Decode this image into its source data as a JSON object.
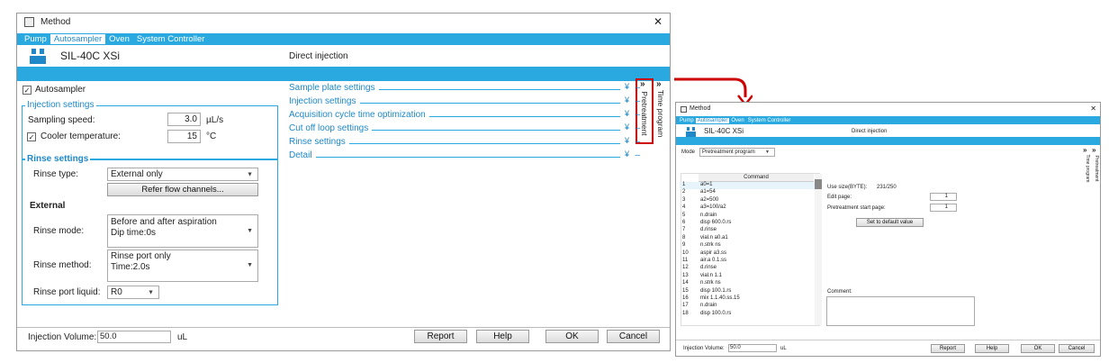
{
  "main": {
    "title": "Method",
    "close": "✕",
    "tabs": [
      "Pump",
      "Autosampler",
      "Oven",
      "System Controller"
    ],
    "model": "SIL-40C XSi",
    "mode_label": "Direct injection",
    "autosampler_check": "Autosampler",
    "injection_settings": {
      "title": "Injection settings",
      "sampling_speed_label": "Sampling speed:",
      "sampling_speed_value": "3.0",
      "sampling_speed_unit": "µL/s",
      "cooler_label": "Cooler temperature:",
      "cooler_value": "15",
      "cooler_unit": "°C"
    },
    "rinse_settings": {
      "title": "Rinse settings",
      "rinse_type_label": "Rinse type:",
      "rinse_type_value": "External only",
      "refer_button": "Refer flow channels...",
      "external_heading": "External",
      "rinse_mode_label": "Rinse mode:",
      "rinse_mode_line1": "Before and after aspiration",
      "rinse_mode_line2": "Dip time:0s",
      "rinse_method_label": "Rinse method:",
      "rinse_method_line1": "Rinse port only",
      "rinse_method_line2": "Time:2.0s",
      "rinse_port_label": "Rinse port liquid:",
      "rinse_port_value": "R0"
    },
    "sections": [
      "Sample plate settings",
      "Injection settings",
      "Acquisition cycle time optimization",
      "Cut off loop settings",
      "Rinse settings",
      "Detail"
    ],
    "side_tabs": {
      "pretreatment": "Pretreatment",
      "time_program": "Time program"
    },
    "footer": {
      "injection_volume_label": "Injection Volume:",
      "injection_volume_value": "50.0",
      "injection_volume_unit": "uL",
      "report": "Report",
      "help": "Help",
      "ok": "OK",
      "cancel": "Cancel"
    }
  },
  "second": {
    "title": "Method",
    "close": "✕",
    "tabs": [
      "Pump",
      "Autosampler",
      "Oven",
      "System Controller"
    ],
    "model": "SIL-40C XSi",
    "mode_label_top": "Direct injection",
    "mode_label": "Mode",
    "mode_value": "Pretreatment program",
    "command_header": "Command",
    "commands": [
      {
        "n": "1",
        "c": "a0=1"
      },
      {
        "n": "2",
        "c": "a1=54"
      },
      {
        "n": "3",
        "c": "a2=500"
      },
      {
        "n": "4",
        "c": "a3=100/a2"
      },
      {
        "n": "5",
        "c": "n.drain"
      },
      {
        "n": "6",
        "c": "disp 600.0.rs"
      },
      {
        "n": "7",
        "c": "d.rinse"
      },
      {
        "n": "8",
        "c": "vial.n a0.a1"
      },
      {
        "n": "9",
        "c": "n.strk ns"
      },
      {
        "n": "10",
        "c": "aspir a3.ss"
      },
      {
        "n": "11",
        "c": "air.a 0.1.ss"
      },
      {
        "n": "12",
        "c": "d.rinse"
      },
      {
        "n": "13",
        "c": "vial.n 1.1"
      },
      {
        "n": "14",
        "c": "n.strk ns"
      },
      {
        "n": "15",
        "c": "disp 100.1.rs"
      },
      {
        "n": "16",
        "c": "mix 1.1.40.ss.15"
      },
      {
        "n": "17",
        "c": "n.drain"
      },
      {
        "n": "18",
        "c": "disp 100.0.rs"
      }
    ],
    "use_size_label": "Use size(BYTE):",
    "use_size_value": "231/250",
    "edit_page_label": "Edit page:",
    "edit_page_value": "1",
    "start_page_label": "Pretreatment start page:",
    "start_page_value": "1",
    "default_button": "Set to default value",
    "comment_label": "Comment:",
    "side_tabs": {
      "time_program": "Time program",
      "pretreatment": "Pretreatment"
    },
    "footer": {
      "injection_volume_label": "Injection Volume:",
      "injection_volume_value": "50.0",
      "injection_volume_unit": "uL",
      "report": "Report",
      "help": "Help",
      "ok": "OK",
      "cancel": "Cancel"
    }
  },
  "colors": {
    "accent": "#29a9e0",
    "highlight_box": "#cc0000"
  }
}
